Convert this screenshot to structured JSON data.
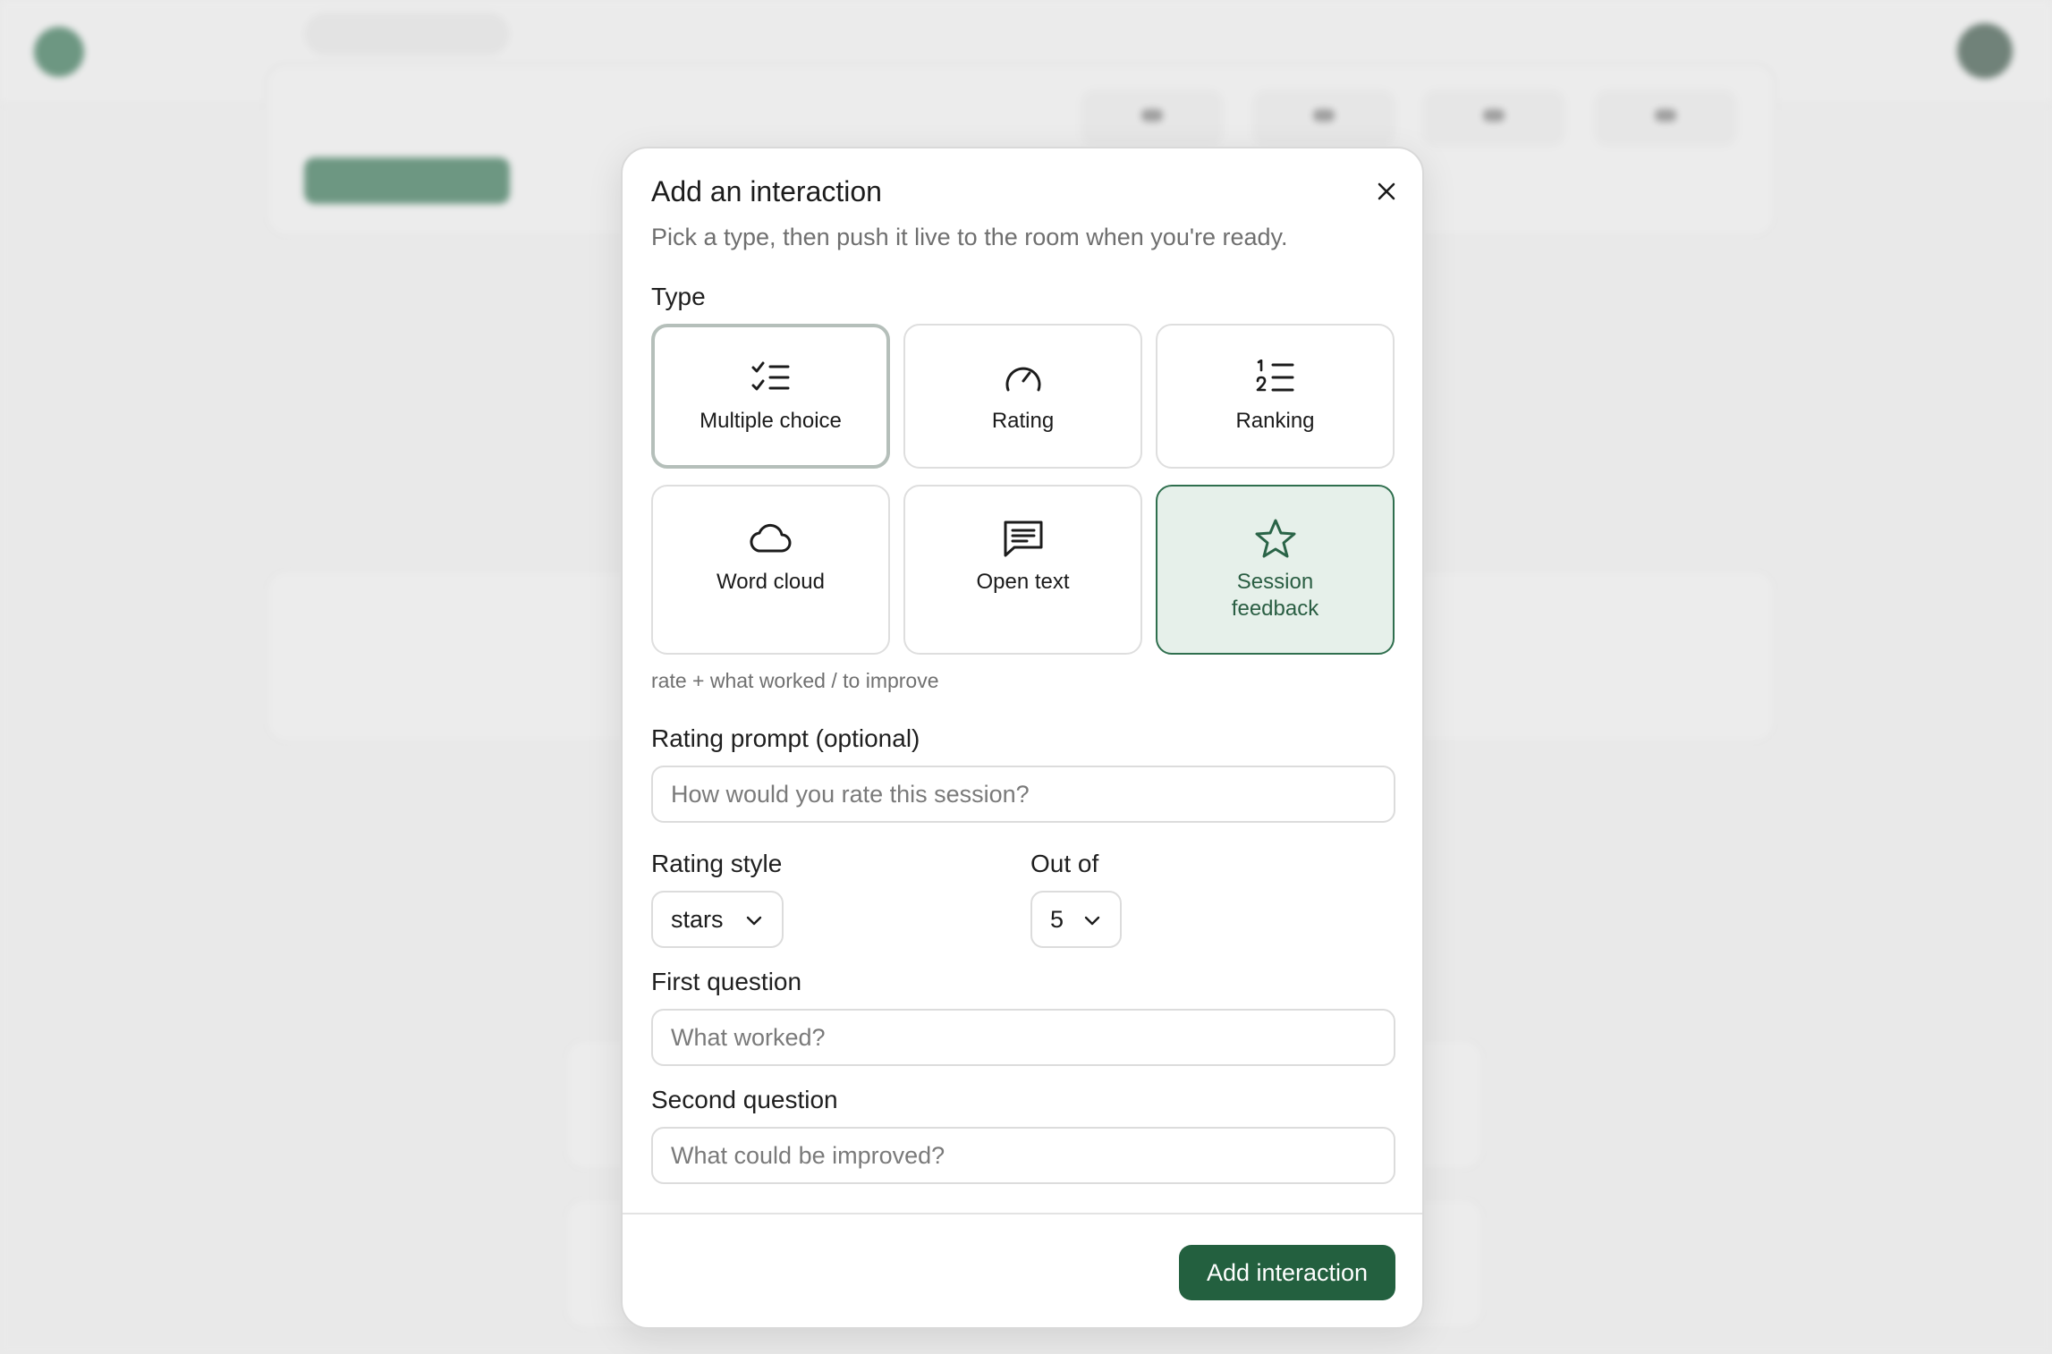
{
  "modal": {
    "title": "Add an interaction",
    "subtitle": "Pick a type, then push it live to the room when you're ready.",
    "type_label": "Type",
    "types": [
      {
        "label": "Multiple choice",
        "icon": "list-checks-icon"
      },
      {
        "label": "Rating",
        "icon": "gauge-icon"
      },
      {
        "label": "Ranking",
        "icon": "ordered-list-icon"
      },
      {
        "label": "Word cloud",
        "icon": "cloud-icon"
      },
      {
        "label": "Open text",
        "icon": "message-text-icon"
      },
      {
        "label": "Session feedback",
        "icon": "star-icon"
      }
    ],
    "selected_type": "Session feedback",
    "type_hint": "rate + what worked / to improve",
    "rating_prompt": {
      "label": "Rating prompt (optional)",
      "placeholder": "How would you rate this session?",
      "value": ""
    },
    "rating_style": {
      "label": "Rating style",
      "value": "stars"
    },
    "out_of": {
      "label": "Out of",
      "value": "5"
    },
    "first_question": {
      "label": "First question",
      "placeholder": "What worked?",
      "value": ""
    },
    "second_question": {
      "label": "Second question",
      "placeholder": "What could be improved?",
      "value": ""
    },
    "submit_label": "Add interaction"
  },
  "colors": {
    "primary": "#23603f",
    "selected_bg": "#e6f0ea",
    "selected_border": "#2f6f4e"
  }
}
